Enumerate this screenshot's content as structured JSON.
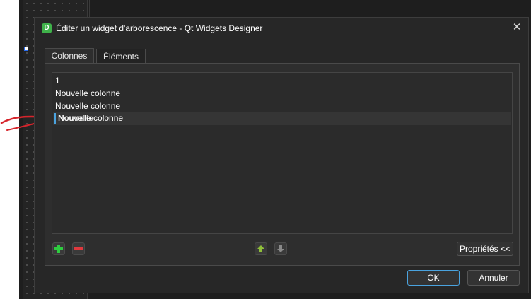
{
  "dialog": {
    "title": "Éditer un widget d'arborescence - Qt Widgets Designer",
    "app_icon_letter": "D",
    "close_symbol": "✕"
  },
  "tabs": [
    {
      "label": "Colonnes",
      "active": true
    },
    {
      "label": "Éléments",
      "active": false
    }
  ],
  "columns": {
    "items": [
      "1",
      "Nouvelle colonne",
      "Nouvelle colonne"
    ],
    "editing_value": "Nouvelle colonne",
    "ghost_text": "Nouvelle"
  },
  "toolbar": {
    "add_icon": "plus-icon",
    "remove_icon": "minus-icon",
    "move_up_icon": "arrow-up-icon",
    "move_down_icon": "arrow-down-icon",
    "properties_label": "Propriétés <<"
  },
  "buttons": {
    "ok": "OK",
    "cancel": "Annuler"
  },
  "colors": {
    "accent": "#4aa3df",
    "add_green": "#2ecc40",
    "remove_red": "#e0393e",
    "annotation_red": "#d6252c",
    "app_icon_green": "#3fb24a"
  }
}
